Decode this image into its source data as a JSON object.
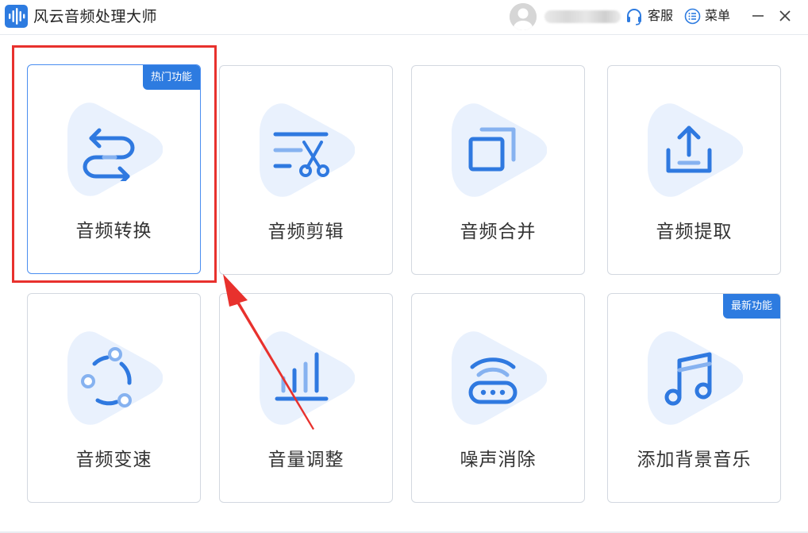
{
  "app": {
    "title": "风云音频处理大师",
    "accent_color": "#2d7be0",
    "blob_color": "#e9f1fd",
    "icon_color": "#2f79e0"
  },
  "header": {
    "avatar_icon": "user-avatar-icon",
    "service_label": "客服",
    "service_icon": "headset-icon",
    "menu_label": "菜单",
    "menu_icon": "list-menu-icon",
    "minimize_icon": "minimize-icon",
    "close_icon": "close-icon"
  },
  "tools": [
    {
      "label": "音频转换",
      "icon": "convert-arrows-icon",
      "badge": "热门功能",
      "selected": true
    },
    {
      "label": "音频剪辑",
      "icon": "scissors-cut-icon",
      "badge": "",
      "selected": false
    },
    {
      "label": "音频合并",
      "icon": "merge-windows-icon",
      "badge": "",
      "selected": false
    },
    {
      "label": "音频提取",
      "icon": "upload-tray-icon",
      "badge": "",
      "selected": false
    },
    {
      "label": "音频变速",
      "icon": "speed-cycle-icon",
      "badge": "",
      "selected": false
    },
    {
      "label": "音量调整",
      "icon": "volume-bars-icon",
      "badge": "",
      "selected": false
    },
    {
      "label": "噪声消除",
      "icon": "router-wifi-icon",
      "badge": "",
      "selected": false
    },
    {
      "label": "添加背景音乐",
      "icon": "music-note-icon",
      "badge": "最新功能",
      "selected": false
    }
  ],
  "annotation": {
    "highlight_color": "#e8312d"
  }
}
